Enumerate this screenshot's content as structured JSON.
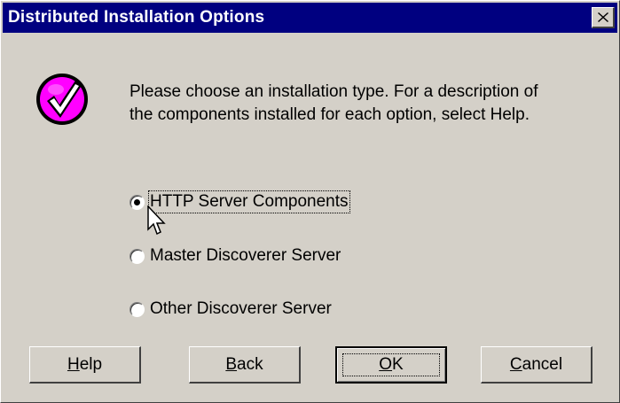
{
  "dialog": {
    "title": "Distributed Installation Options",
    "close_glyph": "✕"
  },
  "icon": {
    "name": "checkmark-icon",
    "color": "#ff00ff"
  },
  "instructions": {
    "line1": "Please choose an installation type.  For a description of",
    "line2": "the components installed for each option, select Help."
  },
  "options": [
    {
      "label": "HTTP Server Components",
      "selected": true
    },
    {
      "label": "Master Discoverer Server",
      "selected": false
    },
    {
      "label": "Other Discoverer Server",
      "selected": false
    }
  ],
  "buttons": {
    "help": {
      "first": "H",
      "rest": "elp"
    },
    "back": {
      "first": "B",
      "rest": "ack"
    },
    "ok": {
      "first": "O",
      "rest": "K"
    },
    "cancel": {
      "first": "C",
      "rest": "ancel"
    }
  },
  "colors": {
    "titlebar": "#000080",
    "face": "#d4d0c8"
  }
}
